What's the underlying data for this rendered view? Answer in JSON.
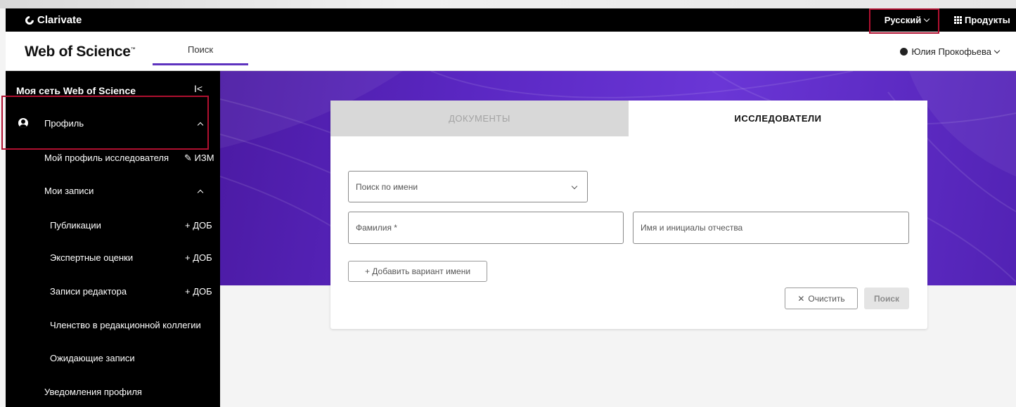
{
  "header": {
    "brand": "Clarivate",
    "language": "Русский",
    "products": "Продукты"
  },
  "navbar": {
    "logo": "Web of Science",
    "logo_tm": "™",
    "search_tab": "Поиск",
    "user_name": "Юлия Прокофьева"
  },
  "sidebar": {
    "heading": "Моя сеть Web of Science",
    "collapse_glyph": "I<",
    "profile": "Профиль",
    "my_researcher_profile": "Мой профиль исследователя",
    "edit_action": "ИЗМ",
    "my_records": "Мои записи",
    "publications": "Публикации",
    "peer_reviews": "Экспертные оценки",
    "editor_records": "Записи редактора",
    "add_action": "+ ДОБ",
    "editorial_board": "Членство в редакционной коллегии",
    "pending_records": "Ожидающие записи",
    "profile_notifications": "Уведомления профиля"
  },
  "search_card": {
    "tab_documents": "ДОКУМЕНТЫ",
    "tab_researchers": "ИССЛЕДОВАТЕЛИ",
    "search_by": "Поиск по имени",
    "last_name_placeholder": "Фамилия *",
    "first_name_placeholder": "Имя и инициалы отчества",
    "add_name_variant": "+ Добавить вариант имени",
    "clear_button": "Очистить",
    "search_button": "Поиск"
  },
  "colors": {
    "accent": "#5e33bf",
    "highlight": "#b01030",
    "hero": "#5a27c2"
  }
}
